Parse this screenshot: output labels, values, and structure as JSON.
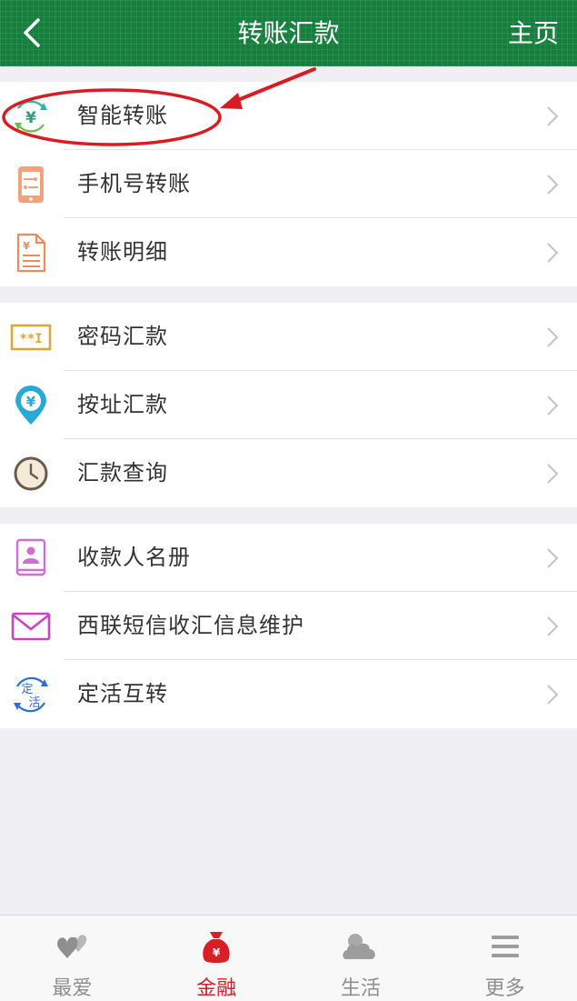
{
  "header": {
    "title": "转账汇款",
    "home_label": "主页"
  },
  "groups": [
    {
      "items": [
        {
          "label": "智能转账",
          "icon": "smart-transfer-yen-icon"
        },
        {
          "label": "手机号转账",
          "icon": "phone-transfer-icon"
        },
        {
          "label": "转账明细",
          "icon": "transfer-detail-document-icon"
        }
      ]
    },
    {
      "items": [
        {
          "label": "密码汇款",
          "icon": "password-remit-icon"
        },
        {
          "label": "按址汇款",
          "icon": "address-pin-yen-icon"
        },
        {
          "label": "汇款查询",
          "icon": "clock-icon"
        }
      ]
    },
    {
      "items": [
        {
          "label": "收款人名册",
          "icon": "payee-book-icon"
        },
        {
          "label": "西联短信收汇信息维护",
          "icon": "envelope-icon"
        },
        {
          "label": "定活互转",
          "icon": "fixed-current-swap-icon"
        }
      ]
    }
  ],
  "icon_glyphs": {
    "yen": "¥",
    "fixed": "定",
    "current": "活",
    "password": "**I"
  },
  "tabbar": {
    "tabs": [
      {
        "label": "最爱",
        "icon": "hearts-icon",
        "active": false
      },
      {
        "label": "金融",
        "icon": "money-bag-icon",
        "active": true
      },
      {
        "label": "生活",
        "icon": "cloud-icon",
        "active": false
      },
      {
        "label": "更多",
        "icon": "menu-icon",
        "active": false
      }
    ]
  },
  "colors": {
    "header_green": "#15803d",
    "active_red": "#d81e26",
    "annotation_red": "#d91c24"
  }
}
